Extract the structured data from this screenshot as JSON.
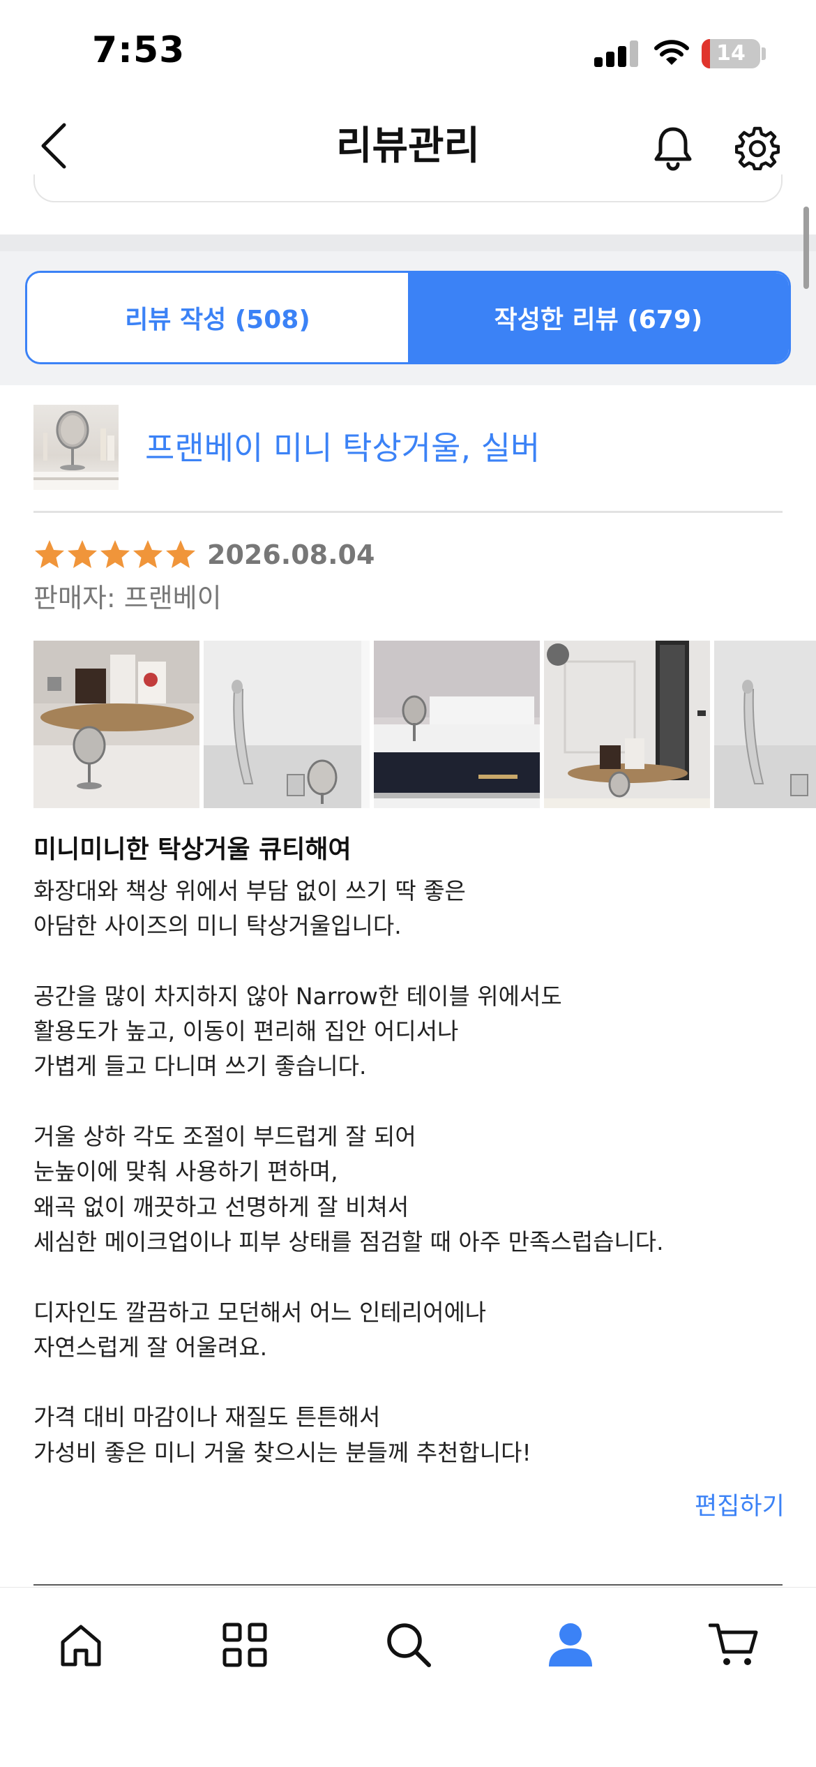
{
  "status_bar": {
    "time": "7:53",
    "battery_percent": "14",
    "battery_level": 0.14,
    "icons": [
      "cellular-signal-icon",
      "wifi-icon",
      "battery-icon"
    ]
  },
  "header": {
    "title": "리뷰관리",
    "icons": [
      "chevron-left-icon",
      "bell-icon",
      "gear-icon"
    ]
  },
  "tabs": [
    {
      "label": "리뷰 작성 (508)",
      "active": false
    },
    {
      "label": "작성한 리뷰 (679)",
      "active": true
    }
  ],
  "review": {
    "product_name": "프랜베이 미니 탁상거울, 실버",
    "rating": 5,
    "max_rating": 5,
    "date": "2026.08.04",
    "seller_label": "판매자: ",
    "seller_name": "프랜베이",
    "photo_count_visible": 5,
    "title": "미니미니한 탁상거울 큐티해여",
    "body_lines": [
      "화장대와 책상 위에서 부담 없이 쓰기 딱 좋은",
      "아담한 사이즈의 미니 탁상거울입니다.",
      "",
      "공간을 많이 차지하지 않아 Narrow한 테이블 위에서도",
      "활용도가 높고, 이동이 편리해 집안 어디서나",
      "가볍게 들고 다니며 쓰기 좋습니다.",
      "",
      "거울 상하 각도 조절이 부드럽게 잘 되어",
      "눈높이에 맞춰 사용하기 편하며,",
      "왜곡 없이 깨끗하고 선명하게 잘 비쳐서",
      "세심한 메이크업이나 피부 상태를 점검할 때 아주 만족스럽습니다.",
      "",
      "디자인도 깔끔하고 모던해서 어느 인테리어에나",
      "자연스럽게 잘 어울려요.",
      "",
      "가격 대비 마감이나 재질도 튼튼해서",
      "가성비 좋은 미니 거울 찾으시는 분들께 추천합니다!"
    ],
    "edit_label": "편집하기"
  },
  "tab_bar": {
    "items": [
      "home-icon",
      "grid-icon",
      "search-icon",
      "profile-icon",
      "cart-icon"
    ],
    "active": "profile-icon"
  },
  "colors": {
    "accent": "#3b82f6",
    "star": "#f0953a",
    "muted_text": "#777777"
  }
}
